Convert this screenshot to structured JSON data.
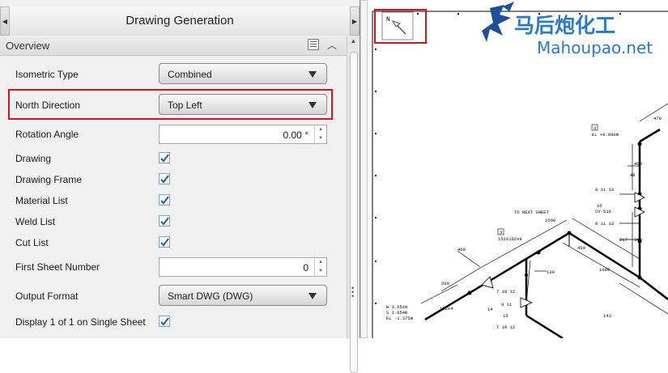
{
  "panel": {
    "title": "Drawing Generation",
    "section": "Overview",
    "rows": {
      "isometric_type": {
        "label": "Isometric Type",
        "value": "Combined"
      },
      "north_direction": {
        "label": "North Direction",
        "value": "Top Left"
      },
      "rotation_angle": {
        "label": "Rotation Angle",
        "value": "0.00 °"
      },
      "drawing": {
        "label": "Drawing",
        "checked": true
      },
      "drawing_frame": {
        "label": "Drawing Frame",
        "checked": true
      },
      "material_list": {
        "label": "Material List",
        "checked": true
      },
      "weld_list": {
        "label": "Weld List",
        "checked": true
      },
      "cut_list": {
        "label": "Cut List",
        "checked": true
      },
      "first_sheet_number": {
        "label": "First Sheet Number",
        "value": "0"
      },
      "output_format": {
        "label": "Output Format",
        "value": "Smart DWG (DWG)"
      },
      "display_single": {
        "label": "Display 1 of 1 on Single Sheet",
        "checked": true
      }
    }
  },
  "drawing": {
    "north_label": "N",
    "watermark": {
      "brand_cn": "马后炮化工",
      "brand_en": "Mahoupao.net"
    },
    "annotations": {
      "elev_top": "EL +0.080m",
      "to_next": "TO NEXT SHEET",
      "size1": "152x102x9",
      "n470": "470",
      "n460": "460",
      "n48": "48",
      "n340": "340",
      "n130": "130",
      "n1000": "1000",
      "n1500": "1500",
      "n1000b": "1000",
      "n450": "450",
      "n200": "200",
      "n143": "143",
      "n217": "217",
      "tag3": "3",
      "tag3b": "3",
      "tag16": "16",
      "tag14": "14",
      "tag15": "15",
      "tag7a": "7 10 12",
      "tag7b": "7 10 12",
      "tag8a": "8 11 13",
      "tag8b": "8 11 13",
      "tag9": "9 11",
      "tag16b": "CV-516",
      "size2": "152x4",
      "elev_left1": "W 3.651m",
      "elev_left2": "S 1.654m",
      "elev_left3": "EL -1.375m"
    }
  },
  "colors": {
    "highlight": "#d0161b",
    "pipe": "#000000",
    "brand": "#2a7ac6"
  }
}
